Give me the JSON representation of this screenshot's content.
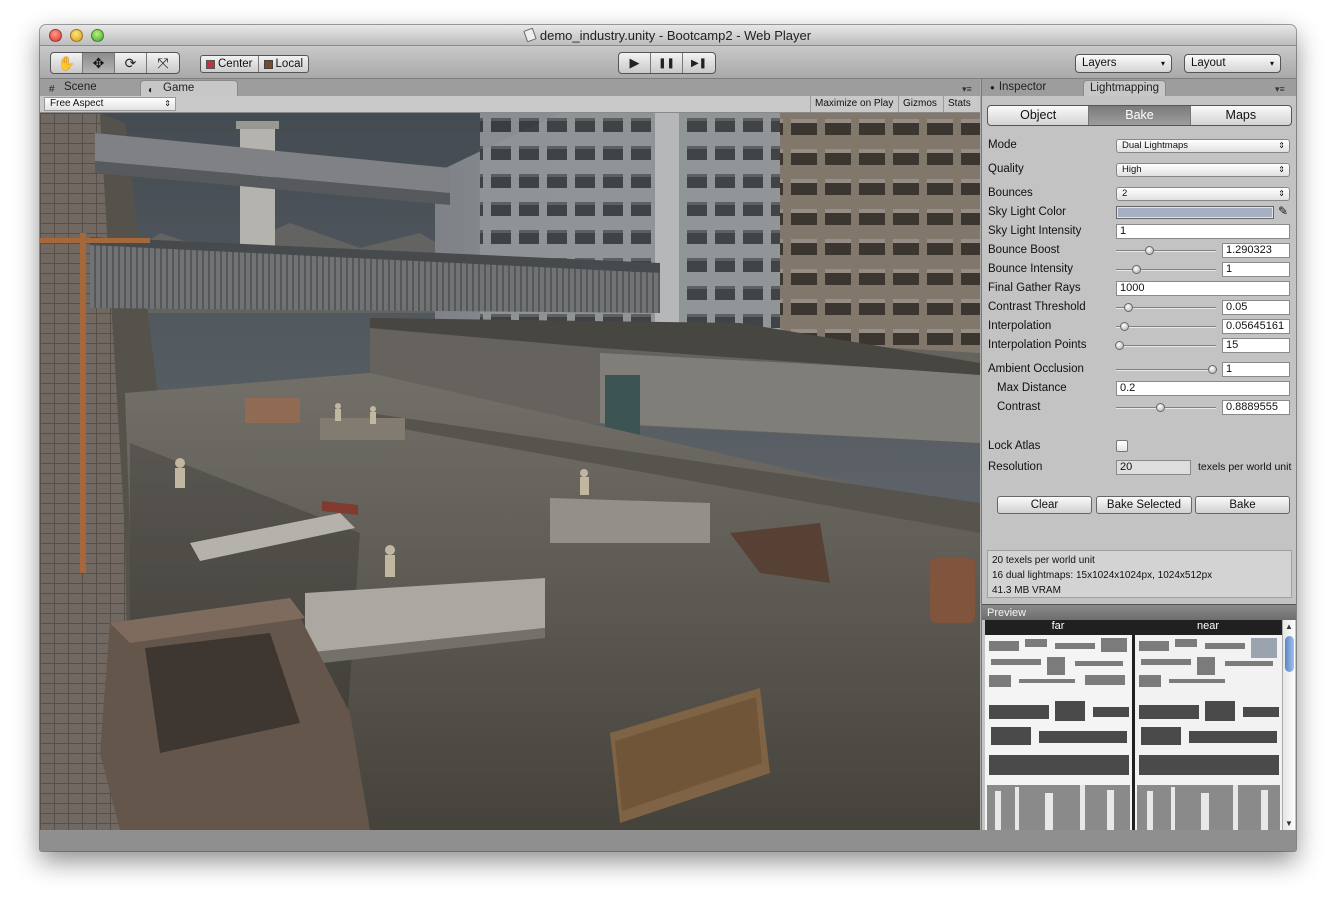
{
  "window": {
    "title": "demo_industry.unity - Bootcamp2 - Web Player"
  },
  "toolbar": {
    "transform_tools": [
      {
        "icon": "hand-icon",
        "glyph": "✋"
      },
      {
        "icon": "move-icon",
        "glyph": "✥"
      },
      {
        "icon": "rotate-icon",
        "glyph": "⟳"
      },
      {
        "icon": "scale-icon",
        "glyph": "⤧"
      }
    ],
    "pivot_label": "Center",
    "space_label": "Local",
    "play_glyph": "▶",
    "pause_glyph": "❚❚",
    "step_glyph": "▶❚",
    "layers_label": "Layers",
    "layout_label": "Layout",
    "dropdown_caret": "▾"
  },
  "left_tabs": {
    "scene_label": "Scene",
    "scene_icon": "#",
    "game_label": "Game",
    "game_icon": "◐",
    "menu_icon": "▾≡"
  },
  "gamebar": {
    "aspect_label": "Free Aspect",
    "aspect_arrows": "⇕",
    "maximize_label": "Maximize on Play",
    "gizmos_label": "Gizmos",
    "stats_label": "Stats"
  },
  "right_tabs": {
    "inspector_label": "Inspector",
    "inspector_icon": "●",
    "lightmapping_label": "Lightmapping",
    "menu_icon": "▾≡"
  },
  "lightmapping": {
    "segments": [
      "Object",
      "Bake",
      "Maps"
    ],
    "active_segment": "Bake",
    "mode": {
      "label": "Mode",
      "value": "Dual Lightmaps"
    },
    "quality": {
      "label": "Quality",
      "value": "High"
    },
    "bounces": {
      "label": "Bounces",
      "value": "2"
    },
    "sky_light_color": {
      "label": "Sky Light Color",
      "color": "#a7afc3"
    },
    "sky_light_intensity": {
      "label": "Sky Light Intensity",
      "value": "1"
    },
    "bounce_boost": {
      "label": "Bounce Boost",
      "value": "1.290323",
      "slider": 0.33
    },
    "bounce_intensity": {
      "label": "Bounce Intensity",
      "value": "1",
      "slider": 0.2
    },
    "final_gather_rays": {
      "label": "Final Gather Rays",
      "value": "1000"
    },
    "contrast_threshold": {
      "label": "Contrast Threshold",
      "value": "0.05",
      "slider": 0.12
    },
    "interpolation": {
      "label": "Interpolation",
      "value": "0.05645161",
      "slider": 0.08
    },
    "interpolation_points": {
      "label": "Interpolation Points",
      "value": "15",
      "slider": 0.03
    },
    "ambient_occlusion": {
      "label": "Ambient Occlusion",
      "value": "1",
      "slider": 0.96
    },
    "max_distance": {
      "label": "Max Distance",
      "value": "0.2"
    },
    "contrast": {
      "label": "Contrast",
      "value": "0.8889555",
      "slider": 0.44
    },
    "lock_atlas": {
      "label": "Lock Atlas",
      "checked": false
    },
    "resolution": {
      "label": "Resolution",
      "value": "20",
      "unit": "texels per world unit"
    },
    "buttons": {
      "clear": "Clear",
      "bake_selected": "Bake Selected",
      "bake": "Bake"
    },
    "info": [
      "20 texels per world unit",
      "16 dual lightmaps: 15x1024x1024px, 1024x512px",
      "41.3 MB VRAM"
    ]
  },
  "preview": {
    "title": "Preview",
    "far_label": "far",
    "near_label": "near",
    "scroll_up": "▲",
    "scroll_down": "▼"
  }
}
